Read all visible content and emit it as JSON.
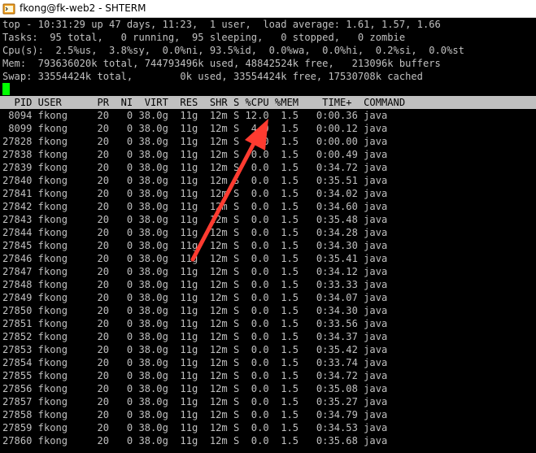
{
  "window": {
    "title": "fkong@fk-web2 - SHTERM",
    "colors": {
      "titlebar_bg": "#ffffff",
      "terminal_bg": "#000000",
      "terminal_fg": "#c0c0c0",
      "header_bg": "#c0c0c0",
      "cursor": "#00ff00",
      "arrow": "#ff3b30"
    },
    "icon": "terminal-app-icon"
  },
  "summary": {
    "line1": "top - 10:31:29 up 47 days, 11:23,  1 user,  load average: 1.61, 1.57, 1.66",
    "line2": "Tasks:  95 total,   0 running,  95 sleeping,   0 stopped,   0 zombie",
    "line3": "Cpu(s):  2.5%us,  3.8%sy,  0.0%ni, 93.5%id,  0.0%wa,  0.0%hi,  0.2%si,  0.0%st",
    "line4": "Mem:  793636020k total, 744793496k used, 48842524k free,   213096k buffers",
    "line5": "Swap: 33554424k total,        0k used, 33554424k free, 17530708k cached"
  },
  "table": {
    "header": "  PID USER      PR  NI  VIRT  RES  SHR S %CPU %MEM    TIME+  COMMAND",
    "rows": [
      " 8094 fkong     20   0 38.0g  11g  12m S 12.0  1.5   0:00.36 java",
      " 8099 fkong     20   0 38.0g  11g  12m S  4.0  1.5   0:00.12 java",
      "27828 fkong     20   0 38.0g  11g  12m S  0.0  1.5   0:00.00 java",
      "27838 fkong     20   0 38.0g  11g  12m S  0.0  1.5   0:00.49 java",
      "27839 fkong     20   0 38.0g  11g  12m S  0.0  1.5   0:34.72 java",
      "27840 fkong     20   0 38.0g  11g  12m S  0.0  1.5   0:35.51 java",
      "27841 fkong     20   0 38.0g  11g  12m S  0.0  1.5   0:34.02 java",
      "27842 fkong     20   0 38.0g  11g  12m S  0.0  1.5   0:34.60 java",
      "27843 fkong     20   0 38.0g  11g  12m S  0.0  1.5   0:35.48 java",
      "27844 fkong     20   0 38.0g  11g  12m S  0.0  1.5   0:34.28 java",
      "27845 fkong     20   0 38.0g  11g  12m S  0.0  1.5   0:34.30 java",
      "27846 fkong     20   0 38.0g  11g  12m S  0.0  1.5   0:35.41 java",
      "27847 fkong     20   0 38.0g  11g  12m S  0.0  1.5   0:34.12 java",
      "27848 fkong     20   0 38.0g  11g  12m S  0.0  1.5   0:33.33 java",
      "27849 fkong     20   0 38.0g  11g  12m S  0.0  1.5   0:34.07 java",
      "27850 fkong     20   0 38.0g  11g  12m S  0.0  1.5   0:34.30 java",
      "27851 fkong     20   0 38.0g  11g  12m S  0.0  1.5   0:33.56 java",
      "27852 fkong     20   0 38.0g  11g  12m S  0.0  1.5   0:34.37 java",
      "27853 fkong     20   0 38.0g  11g  12m S  0.0  1.5   0:35.42 java",
      "27854 fkong     20   0 38.0g  11g  12m S  0.0  1.5   0:33.74 java",
      "27855 fkong     20   0 38.0g  11g  12m S  0.0  1.5   0:34.72 java",
      "27856 fkong     20   0 38.0g  11g  12m S  0.0  1.5   0:35.08 java",
      "27857 fkong     20   0 38.0g  11g  12m S  0.0  1.5   0:35.27 java",
      "27858 fkong     20   0 38.0g  11g  12m S  0.0  1.5   0:34.79 java",
      "27859 fkong     20   0 38.0g  11g  12m S  0.0  1.5   0:34.53 java",
      "27860 fkong     20   0 38.0g  11g  12m S  0.0  1.5   0:35.68 java"
    ]
  }
}
